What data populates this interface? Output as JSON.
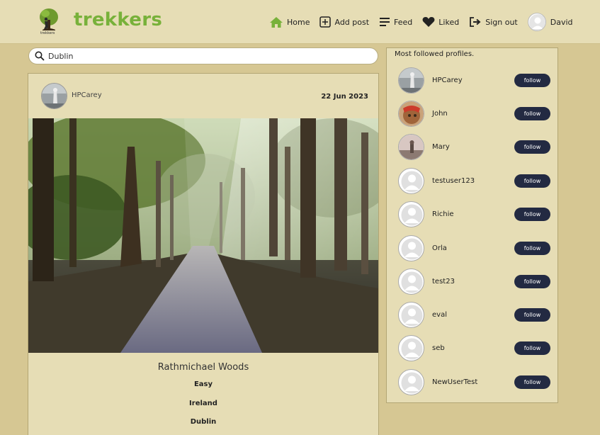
{
  "brand": {
    "name": "trekkers",
    "logo_text": "trekkers"
  },
  "nav": {
    "home": "Home",
    "add_post": "Add post",
    "feed": "Feed",
    "liked": "Liked",
    "sign_out": "Sign out",
    "user": "David"
  },
  "search": {
    "value": "Dublin",
    "placeholder": "Search posts"
  },
  "post": {
    "author": "HPCarey",
    "date": "22 Jun 2023",
    "title": "Rathmichael Woods",
    "difficulty": "Easy",
    "country": "Ireland",
    "county": "Dublin"
  },
  "sidebar": {
    "title": "Most followed profiles.",
    "follow_label": "follow",
    "profiles": [
      {
        "name": "HPCarey",
        "avatar": "photo-hpcarey"
      },
      {
        "name": "John",
        "avatar": "photo-john"
      },
      {
        "name": "Mary",
        "avatar": "photo-mary"
      },
      {
        "name": "testuser123",
        "avatar": "default-avatar"
      },
      {
        "name": "Richie",
        "avatar": "default-avatar"
      },
      {
        "name": "Orla",
        "avatar": "default-avatar"
      },
      {
        "name": "test23",
        "avatar": "default-avatar"
      },
      {
        "name": "eval",
        "avatar": "default-avatar"
      },
      {
        "name": "seb",
        "avatar": "default-avatar"
      },
      {
        "name": "NewUserTest",
        "avatar": "default-avatar"
      }
    ]
  },
  "colors": {
    "background": "#d6c793",
    "panel": "#e6ddb5",
    "brand": "#78b13a",
    "button": "#232a42"
  }
}
